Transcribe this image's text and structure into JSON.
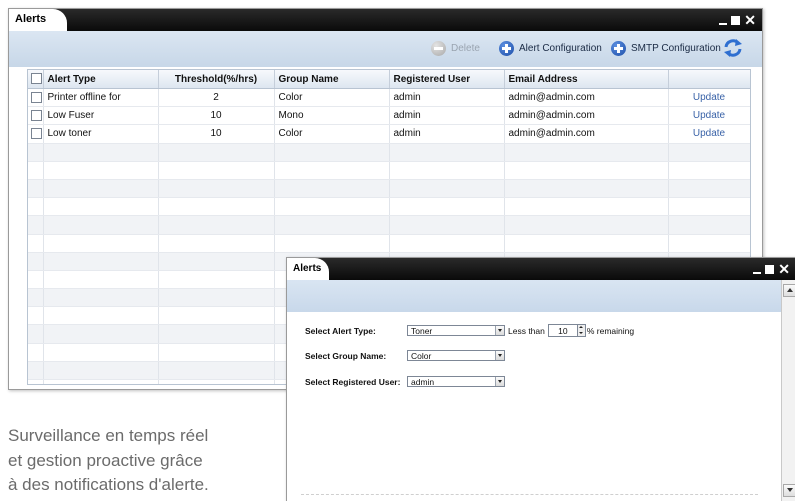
{
  "main_window": {
    "title": "Alerts",
    "toolbar": {
      "delete_label": "Delete",
      "alert_config_label": "Alert Configuration",
      "smtp_config_label": "SMTP Configuration"
    },
    "table": {
      "columns": [
        "",
        "Alert Type",
        "Threshold(%/hrs)",
        "Group Name",
        "Registered User",
        "Email Address",
        ""
      ],
      "rows": [
        {
          "alert_type": "Printer offline for",
          "threshold": "2",
          "group": "Color",
          "user": "admin",
          "email": "admin@admin.com",
          "action": "Update"
        },
        {
          "alert_type": "Low Fuser",
          "threshold": "10",
          "group": "Mono",
          "user": "admin",
          "email": "admin@admin.com",
          "action": "Update"
        },
        {
          "alert_type": "Low toner",
          "threshold": "10",
          "group": "Color",
          "user": "admin",
          "email": "admin@admin.com",
          "action": "Update"
        }
      ],
      "empty_rows": 14
    }
  },
  "caption": {
    "line1": "Surveillance en temps réel",
    "line2": "et gestion proactive grâce",
    "line3": "à des notifications d'alerte."
  },
  "dialog": {
    "title": "Alerts",
    "alert_type_label": "Select Alert Type:",
    "alert_type_value": "Toner",
    "less_than_label": "Less than",
    "threshold_value": "10",
    "remaining_label": "% remaining",
    "group_label": "Select Group Name:",
    "group_value": "Color",
    "user_label": "Select Registered User:",
    "user_value": "admin"
  },
  "colors": {
    "titlebar": "#0a0a0a",
    "toolbar_band": "#c7d7e8",
    "accent_blue": "#1d4ea8",
    "link": "#3a63a8"
  }
}
